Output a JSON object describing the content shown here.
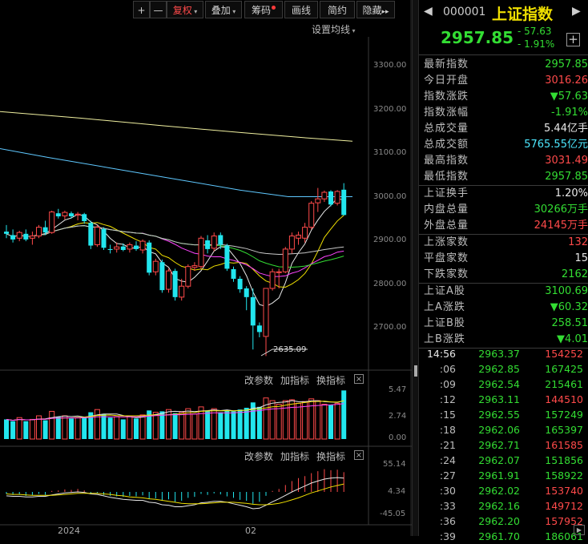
{
  "toolbar": {
    "plus": "+",
    "minus": "—",
    "fuquan": "复权",
    "diejia": "叠加",
    "chouma": "筹码",
    "huaxian": "画线",
    "jianyue": "简约",
    "yincang": "隐藏",
    "more": "▸▸"
  },
  "main_chart": {
    "settings_label": "设置均线",
    "y_ticks": [
      "3300.00",
      "3200.00",
      "3100.00",
      "3000.00",
      "2900.00",
      "2800.00",
      "2700.00"
    ],
    "low_annotation": "2635.09"
  },
  "volume_panel": {
    "menu": [
      "改参数",
      "加指标",
      "换指标"
    ],
    "close": "×",
    "y_ticks": [
      "5.47",
      "2.74",
      "0.00"
    ]
  },
  "macd_panel": {
    "menu": [
      "改参数",
      "加指标",
      "换指标"
    ],
    "close": "×",
    "y_ticks": [
      "55.14",
      "4.34",
      "-45.05"
    ]
  },
  "x_axis": {
    "labels": [
      "2024",
      "02"
    ]
  },
  "header": {
    "code": "000001",
    "name": "上证指数",
    "price": "2957.85",
    "change": "- 57.63",
    "change_pct": "- 1.91%",
    "add": "+"
  },
  "quote": [
    {
      "label": "最新指数",
      "value": "2957.85",
      "color": "green"
    },
    {
      "label": "今日开盘",
      "value": "3016.26",
      "color": "red"
    },
    {
      "label": "指数涨跌",
      "value": "▼57.63",
      "color": "green"
    },
    {
      "label": "指数涨幅",
      "value": "-1.91%",
      "color": "green"
    },
    {
      "label": "总成交量",
      "value": "5.44",
      "unit": "亿手",
      "color": "white"
    },
    {
      "label": "总成交额",
      "value": "5765.55",
      "unit": "亿元",
      "color": "cyan"
    },
    {
      "label": "最高指数",
      "value": "3031.49",
      "color": "red"
    },
    {
      "label": "最低指数",
      "value": "2957.85",
      "color": "green"
    }
  ],
  "quote2": [
    {
      "label": "上证换手",
      "value": "1.20%",
      "color": "white"
    },
    {
      "label": "内盘总量",
      "value": "30266",
      "unit": "万手",
      "color": "green"
    },
    {
      "label": "外盘总量",
      "value": "24145",
      "unit": "万手",
      "color": "red"
    }
  ],
  "quote3": [
    {
      "label": "上涨家数",
      "value": "132",
      "color": "red"
    },
    {
      "label": "平盘家数",
      "value": "15",
      "color": "white"
    },
    {
      "label": "下跌家数",
      "value": "2162",
      "color": "green"
    }
  ],
  "quote4": [
    {
      "label": "上证A股",
      "value": "3100.69",
      "color": "green"
    },
    {
      "label": "上A涨跌",
      "value": "▼60.32",
      "color": "green"
    },
    {
      "label": "上证B股",
      "value": "258.51",
      "color": "green"
    },
    {
      "label": "上B涨跌",
      "value": "▼4.01",
      "color": "green"
    }
  ],
  "ticks": [
    {
      "time": "14:56",
      "price": "2963.37",
      "vol": "154252",
      "vcolor": "red"
    },
    {
      "time": ":06",
      "price": "2962.85",
      "vol": "167425",
      "vcolor": "green"
    },
    {
      "time": ":09",
      "price": "2962.54",
      "vol": "215461",
      "vcolor": "green"
    },
    {
      "time": ":12",
      "price": "2963.11",
      "vol": "144510",
      "vcolor": "red"
    },
    {
      "time": ":15",
      "price": "2962.55",
      "vol": "157249",
      "vcolor": "green"
    },
    {
      "time": ":18",
      "price": "2962.06",
      "vol": "165397",
      "vcolor": "green"
    },
    {
      "time": ":21",
      "price": "2962.71",
      "vol": "161585",
      "vcolor": "red"
    },
    {
      "time": ":24",
      "price": "2962.07",
      "vol": "151856",
      "vcolor": "green"
    },
    {
      "time": ":27",
      "price": "2961.91",
      "vol": "158922",
      "vcolor": "green"
    },
    {
      "time": ":30",
      "price": "2962.02",
      "vol": "153740",
      "vcolor": "red"
    },
    {
      "time": ":33",
      "price": "2962.16",
      "vol": "149712",
      "vcolor": "red"
    },
    {
      "time": ":36",
      "price": "2962.20",
      "vol": "157952",
      "vcolor": "red"
    },
    {
      "time": ":39",
      "price": "2961.70",
      "vol": "186061",
      "vcolor": "green"
    }
  ],
  "chart_data": {
    "type": "candlestick",
    "ylim": [
      2620,
      3330
    ],
    "candles": [
      {
        "o": 2920,
        "h": 2935,
        "l": 2905,
        "c": 2915
      },
      {
        "o": 2912,
        "h": 2925,
        "l": 2895,
        "c": 2902
      },
      {
        "o": 2905,
        "h": 2922,
        "l": 2898,
        "c": 2918
      },
      {
        "o": 2915,
        "h": 2925,
        "l": 2898,
        "c": 2902
      },
      {
        "o": 2905,
        "h": 2920,
        "l": 2890,
        "c": 2910
      },
      {
        "o": 2910,
        "h": 2935,
        "l": 2905,
        "c": 2930
      },
      {
        "o": 2930,
        "h": 2945,
        "l": 2912,
        "c": 2918
      },
      {
        "o": 2918,
        "h": 2968,
        "l": 2915,
        "c": 2965
      },
      {
        "o": 2962,
        "h": 2972,
        "l": 2950,
        "c": 2955
      },
      {
        "o": 2956,
        "h": 2968,
        "l": 2948,
        "c": 2964
      },
      {
        "o": 2962,
        "h": 2966,
        "l": 2950,
        "c": 2955
      },
      {
        "o": 2958,
        "h": 2965,
        "l": 2946,
        "c": 2960
      },
      {
        "o": 2960,
        "h": 2963,
        "l": 2938,
        "c": 2944
      },
      {
        "o": 2940,
        "h": 2945,
        "l": 2880,
        "c": 2888
      },
      {
        "o": 2890,
        "h": 2935,
        "l": 2885,
        "c": 2930
      },
      {
        "o": 2926,
        "h": 2930,
        "l": 2878,
        "c": 2883
      },
      {
        "o": 2880,
        "h": 2890,
        "l": 2870,
        "c": 2878
      },
      {
        "o": 2880,
        "h": 2895,
        "l": 2872,
        "c": 2885
      },
      {
        "o": 2886,
        "h": 2893,
        "l": 2875,
        "c": 2878
      },
      {
        "o": 2880,
        "h": 2895,
        "l": 2872,
        "c": 2890
      },
      {
        "o": 2888,
        "h": 2898,
        "l": 2876,
        "c": 2880
      },
      {
        "o": 2878,
        "h": 2902,
        "l": 2870,
        "c": 2898
      },
      {
        "o": 2895,
        "h": 2900,
        "l": 2820,
        "c": 2826
      },
      {
        "o": 2828,
        "h": 2858,
        "l": 2820,
        "c": 2852
      },
      {
        "o": 2850,
        "h": 2856,
        "l": 2780,
        "c": 2786
      },
      {
        "o": 2788,
        "h": 2835,
        "l": 2780,
        "c": 2830
      },
      {
        "o": 2830,
        "h": 2835,
        "l": 2762,
        "c": 2770
      },
      {
        "o": 2770,
        "h": 2812,
        "l": 2762,
        "c": 2795
      },
      {
        "o": 2795,
        "h": 2845,
        "l": 2790,
        "c": 2840
      },
      {
        "o": 2838,
        "h": 2850,
        "l": 2830,
        "c": 2842
      },
      {
        "o": 2840,
        "h": 2910,
        "l": 2835,
        "c": 2905
      },
      {
        "o": 2900,
        "h": 2912,
        "l": 2870,
        "c": 2880
      },
      {
        "o": 2882,
        "h": 2918,
        "l": 2875,
        "c": 2910
      },
      {
        "o": 2912,
        "h": 2918,
        "l": 2880,
        "c": 2890
      },
      {
        "o": 2888,
        "h": 2892,
        "l": 2830,
        "c": 2835
      },
      {
        "o": 2834,
        "h": 2840,
        "l": 2805,
        "c": 2812
      },
      {
        "o": 2812,
        "h": 2818,
        "l": 2780,
        "c": 2788
      },
      {
        "o": 2790,
        "h": 2795,
        "l": 2740,
        "c": 2770
      },
      {
        "o": 2770,
        "h": 2790,
        "l": 2650,
        "c": 2705
      },
      {
        "o": 2705,
        "h": 2712,
        "l": 2678,
        "c": 2690
      },
      {
        "o": 2680,
        "h": 2790,
        "l": 2635,
        "c": 2790
      },
      {
        "o": 2790,
        "h": 2835,
        "l": 2785,
        "c": 2828
      },
      {
        "o": 2826,
        "h": 2835,
        "l": 2790,
        "c": 2828
      },
      {
        "o": 2828,
        "h": 2885,
        "l": 2825,
        "c": 2880
      },
      {
        "o": 2880,
        "h": 2918,
        "l": 2870,
        "c": 2910
      },
      {
        "o": 2905,
        "h": 2920,
        "l": 2890,
        "c": 2912
      },
      {
        "o": 2905,
        "h": 2940,
        "l": 2895,
        "c": 2930
      },
      {
        "o": 2930,
        "h": 2990,
        "l": 2925,
        "c": 2985
      },
      {
        "o": 2986,
        "h": 3020,
        "l": 2965,
        "c": 2995
      },
      {
        "o": 2995,
        "h": 3014,
        "l": 2988,
        "c": 3010
      },
      {
        "o": 3012,
        "h": 3015,
        "l": 2978,
        "c": 2982
      },
      {
        "o": 2985,
        "h": 3015,
        "l": 2980,
        "c": 3012
      },
      {
        "o": 3016,
        "h": 3031,
        "l": 2957,
        "c": 2958
      }
    ],
    "volume_ylim": [
      0,
      5.47
    ],
    "volume": [
      2.2,
      2.0,
      2.4,
      2.0,
      2.2,
      2.6,
      2.1,
      3.1,
      2.5,
      2.6,
      2.3,
      2.4,
      2.5,
      3.0,
      3.3,
      2.8,
      2.4,
      2.5,
      2.2,
      2.6,
      2.3,
      2.7,
      3.2,
      3.0,
      3.1,
      3.3,
      2.9,
      3.0,
      3.4,
      2.8,
      3.6,
      3.1,
      3.4,
      3.0,
      3.2,
      3.1,
      3.3,
      3.5,
      4.1,
      3.6,
      4.6,
      4.3,
      3.9,
      4.3,
      4.4,
      4.0,
      4.2,
      4.5,
      4.3,
      3.9,
      3.8,
      4.0,
      5.44
    ],
    "macd_ylim": [
      -45.05,
      55.14
    ],
    "macd_hist": [
      -4,
      -6,
      -5,
      -8,
      -7,
      -4,
      -6,
      2,
      3,
      5,
      4,
      6,
      3,
      -3,
      -2,
      -6,
      -8,
      -9,
      -10,
      -8,
      -9,
      -7,
      -14,
      -13,
      -18,
      -15,
      -20,
      -18,
      -12,
      -10,
      -4,
      -6,
      -3,
      -5,
      -9,
      -12,
      -16,
      -18,
      -24,
      -20,
      -8,
      2,
      6,
      14,
      22,
      28,
      32,
      38,
      42,
      46,
      44,
      45,
      40
    ],
    "macd_dif": [
      -8,
      -9,
      -9,
      -10,
      -10,
      -9,
      -9,
      -6,
      -4,
      -2,
      -1,
      0,
      -1,
      -4,
      -5,
      -8,
      -11,
      -13,
      -15,
      -16,
      -17,
      -17,
      -21,
      -22,
      -26,
      -27,
      -30,
      -30,
      -28,
      -26,
      -22,
      -21,
      -19,
      -19,
      -21,
      -24,
      -27,
      -30,
      -34,
      -33,
      -27,
      -20,
      -14,
      -7,
      0,
      6,
      12,
      18,
      22,
      26,
      28,
      29,
      28
    ],
    "macd_dea": [
      -4,
      -5,
      -5,
      -6,
      -7,
      -7,
      -7,
      -7,
      -6,
      -5,
      -4,
      -3,
      -3,
      -3,
      -3,
      -4,
      -5,
      -7,
      -8,
      -10,
      -11,
      -12,
      -14,
      -15,
      -17,
      -19,
      -21,
      -23,
      -24,
      -24,
      -24,
      -23,
      -22,
      -21,
      -21,
      -21,
      -22,
      -23,
      -25,
      -26,
      -26,
      -25,
      -23,
      -20,
      -16,
      -12,
      -7,
      -2,
      2,
      6,
      10,
      13,
      16
    ]
  }
}
